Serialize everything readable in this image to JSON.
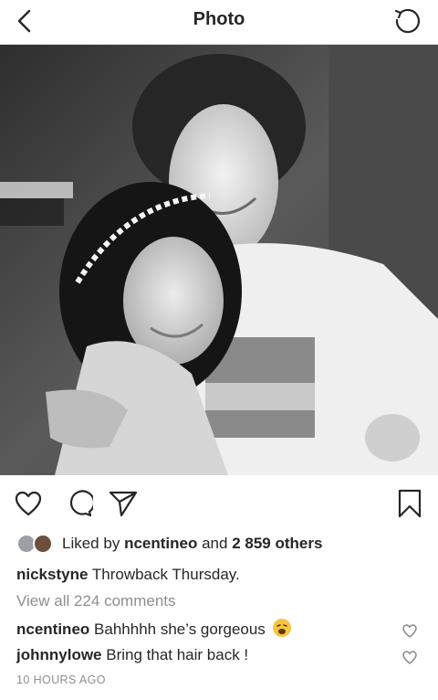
{
  "header": {
    "title": "Photo",
    "back_icon": "chevron-left-icon",
    "refresh_icon": "refresh-icon"
  },
  "post": {
    "liked_by_prefix": "Liked by",
    "liked_by_user": "ncentineo",
    "liked_by_and": "and",
    "liked_by_others": "2 859 others",
    "caption_user": "nickstyne",
    "caption_text": "Throwback Thursday.",
    "view_comments": "View all 224 comments",
    "comments": [
      {
        "user": "ncentineo",
        "text": "Bahhhhh she’s gorgeous",
        "emoji": "weary-face-emoji"
      },
      {
        "user": "johnnylowe",
        "text": "Bring that hair back !"
      }
    ],
    "timestamp": "10 HOURS AGO"
  },
  "icons": {
    "like": "heart-icon",
    "comment": "comment-icon",
    "share": "send-icon",
    "save": "bookmark-icon"
  },
  "colors": {
    "text": "#262626",
    "muted": "#8e8e8e",
    "divider": "#dbdbdb"
  }
}
